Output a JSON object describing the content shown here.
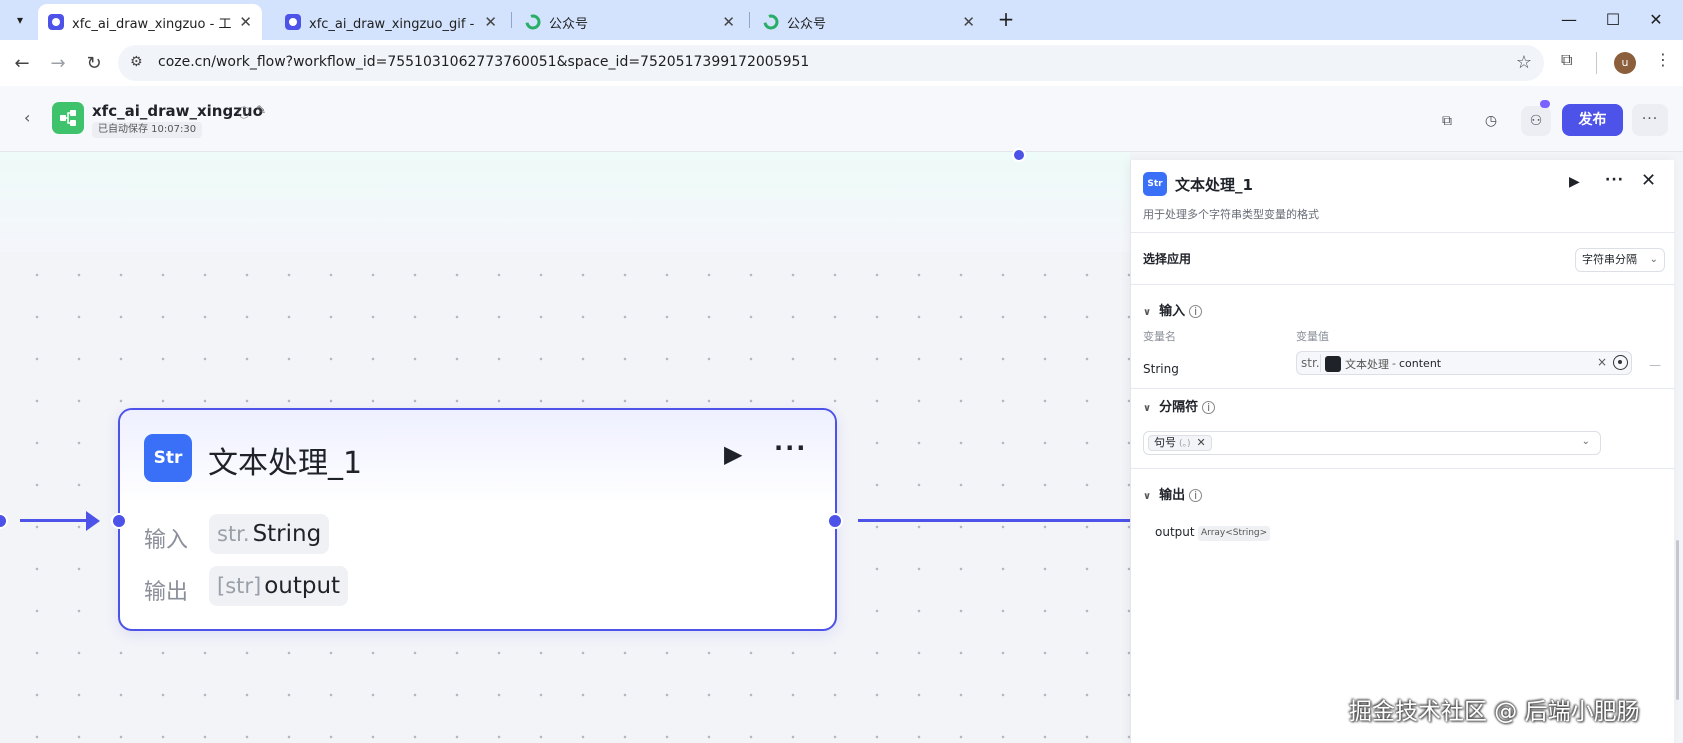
{
  "browser": {
    "tabs": [
      {
        "title": "xfc_ai_draw_xingzuo - 工作流",
        "icon": "coze-icon",
        "active": true
      },
      {
        "title": "xfc_ai_draw_xingzuo_gif - 工作",
        "icon": "coze-icon",
        "active": false
      },
      {
        "title": "公众号",
        "icon": "wechat-icon",
        "active": false
      },
      {
        "title": "公众号",
        "icon": "wechat-icon",
        "active": false
      }
    ],
    "tab_close": "✕",
    "new_tab": "+",
    "url": "coze.cn/work_flow?workflow_id=7551031062773760051&space_id=7520517399172005951",
    "profile_initial": "u"
  },
  "header": {
    "workflow_name": "xfc_ai_draw_xingzuo",
    "autosave": "已自动保存 10:07:30",
    "publish_label": "发布",
    "accent": "#4d53e8"
  },
  "node": {
    "icon_text": "Str",
    "title": "文本处理_1",
    "input_label": "输入",
    "input_type": "str.",
    "input_value": "String",
    "output_label": "输出",
    "output_type": "[str]",
    "output_value": "output"
  },
  "panel": {
    "icon_text": "Str",
    "title": "文本处理_1",
    "description": "用于处理多个字符串类型变量的格式",
    "select_app_label": "选择应用",
    "select_app_value": "字符串分隔",
    "input_section": "输入",
    "col_var_name": "变量名",
    "col_var_value": "变量值",
    "var_name": "String",
    "var_type": "str.",
    "ref_source": "文本处理",
    "ref_sep": "-",
    "ref_field": "content",
    "delimiter_section": "分隔符",
    "delimiter_chip": "句号",
    "delimiter_symbol": "(。)",
    "output_section": "输出",
    "output_name": "output",
    "output_type": "Array<String>"
  },
  "watermark": "掘金技术社区 @ 后端小肥肠"
}
